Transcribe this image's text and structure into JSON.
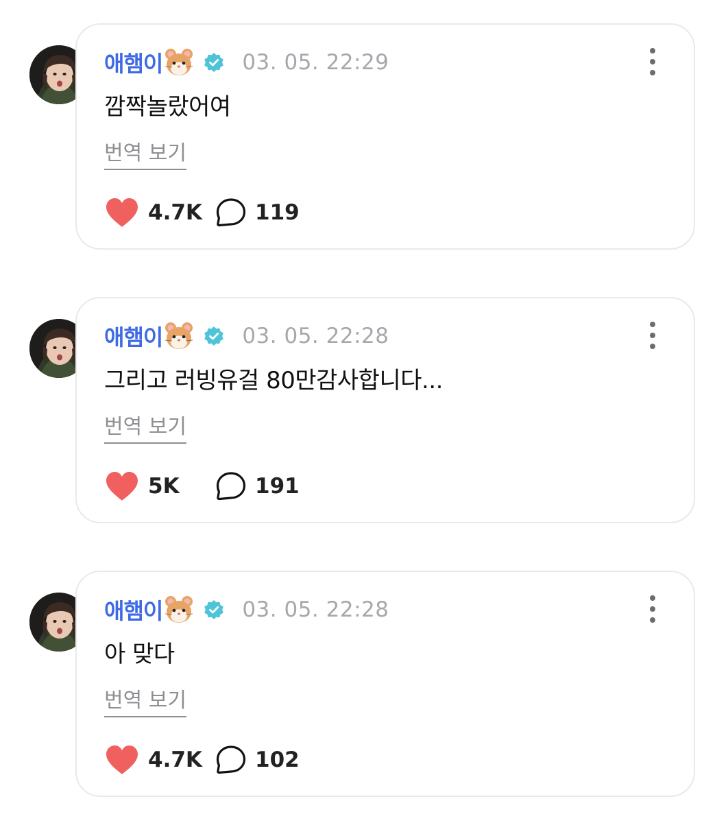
{
  "posts": [
    {
      "author": "애햄이",
      "timestamp": "03. 05. 22:29",
      "text": "깜짝놀랐어여",
      "translate_label": "번역 보기",
      "likes": "4.7K",
      "comments": "119"
    },
    {
      "author": "애햄이",
      "timestamp": "03. 05. 22:28",
      "text": "그리고 러빙유걸 80만감사합니다...",
      "translate_label": "번역 보기",
      "likes": "5K",
      "comments": "191"
    },
    {
      "author": "애햄이",
      "timestamp": "03. 05. 22:28",
      "text": "아 맞다",
      "translate_label": "번역 보기",
      "likes": "4.7K",
      "comments": "102"
    }
  ],
  "icons": {
    "author_badge": "hamster-icon",
    "verified": "verified-badge-icon",
    "more": "more-vertical-icon",
    "like": "heart-icon",
    "comment": "comment-bubble-icon"
  },
  "colors": {
    "author": "#3f6ae4",
    "verified": "#4fc3d8",
    "heart": "#f0605f",
    "timestamp": "#a7a7ad",
    "card_border": "#e9e9ec"
  }
}
